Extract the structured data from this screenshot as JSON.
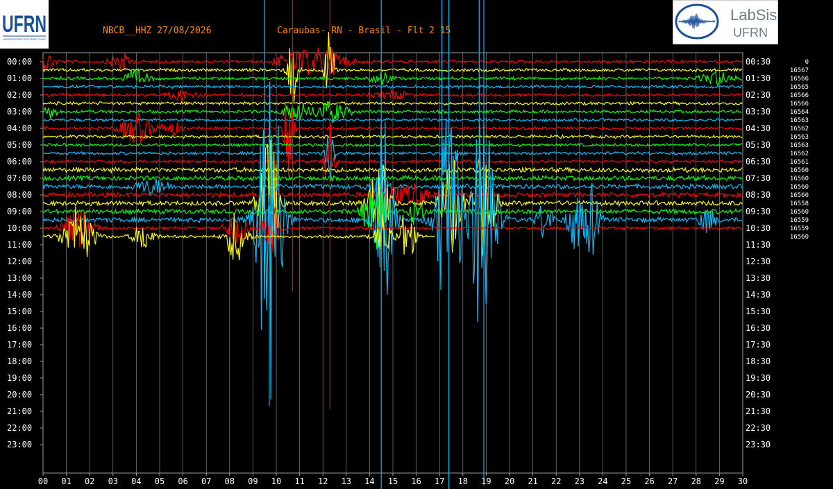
{
  "header": {
    "station": "NBCB__HHZ 27/08/2026",
    "location": "Caraubas- RN - Brasil - Flt 2 15",
    "color": "#ff8c00"
  },
  "logos": {
    "left": {
      "text": "UFRN",
      "subtext": "UNIVERSIDADE FEDERAL DO RIO GRANDE DO NORTE",
      "color": "#1a4f9c"
    },
    "right": {
      "title": "LabSis",
      "subtitle": "UFRN",
      "color": "#6f7d88"
    }
  },
  "chart_data": {
    "type": "helicorder",
    "trace_colors": [
      "#ff0000",
      "#ffff00",
      "#00ff00",
      "#00bfff"
    ],
    "grid_color": "#9a9a9a",
    "x_ticks": [
      "00",
      "01",
      "02",
      "03",
      "04",
      "05",
      "06",
      "07",
      "08",
      "09",
      "10",
      "11",
      "12",
      "13",
      "14",
      "15",
      "16",
      "17",
      "18",
      "19",
      "20",
      "21",
      "22",
      "23",
      "24",
      "25",
      "26",
      "27",
      "28",
      "29",
      "30"
    ],
    "xlim": [
      0,
      30
    ],
    "left_labels": [
      "00:00",
      "01:00",
      "02:00",
      "03:00",
      "04:00",
      "05:00",
      "06:00",
      "07:00",
      "08:00",
      "09:00",
      "10:00",
      "11:00",
      "12:00",
      "13:00",
      "14:00",
      "15:00",
      "16:00",
      "17:00",
      "18:00",
      "19:00",
      "20:00",
      "21:00",
      "22:00",
      "23:00"
    ],
    "right_labels": [
      "00:30",
      "01:30",
      "02:30",
      "03:30",
      "04:30",
      "05:30",
      "06:30",
      "07:30",
      "08:30",
      "09:30",
      "10:30",
      "11:30",
      "12:30",
      "13:30",
      "14:30",
      "15:30",
      "16:30",
      "17:30",
      "18:30",
      "19:30",
      "20:30",
      "21:30",
      "22:30",
      "23:30"
    ],
    "row_values": [
      "0",
      "16567",
      "16566",
      "16565",
      "16566",
      "16566",
      "16564",
      "16563",
      "16562",
      "16563",
      "16563",
      "16562",
      "16561",
      "16560",
      "16560",
      "16560",
      "16560",
      "16558",
      "16560",
      "16559",
      "16559",
      "16560"
    ],
    "traces_plotted_through": "09:30",
    "last_trace_end_minute": 16.8
  }
}
